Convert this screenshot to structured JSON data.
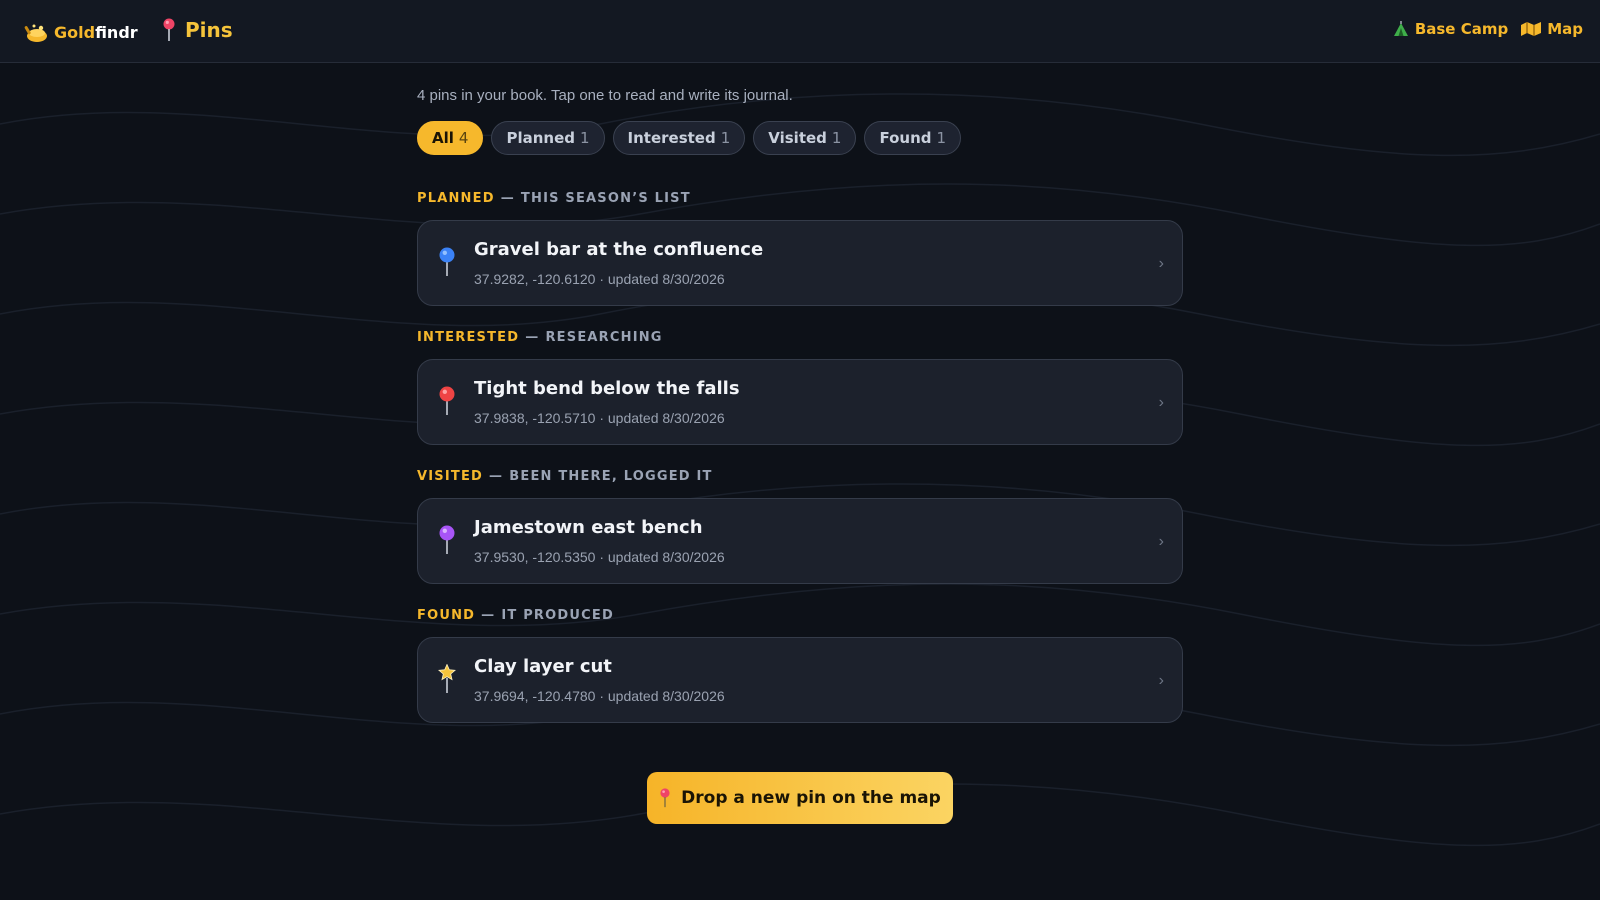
{
  "header": {
    "brand_prefix": "Gold",
    "brand_suffix": "findr",
    "page_title": "Pins",
    "nav": [
      {
        "label": "Base Camp",
        "icon": "tent-icon"
      },
      {
        "label": "Map",
        "icon": "map-icon"
      }
    ]
  },
  "intro": "4 pins in your book. Tap one to read and write its journal.",
  "filters": [
    {
      "label": "All",
      "count": "4",
      "active": true
    },
    {
      "label": "Planned",
      "count": "1"
    },
    {
      "label": "Interested",
      "count": "1"
    },
    {
      "label": "Visited",
      "count": "1"
    },
    {
      "label": "Found",
      "count": "1"
    }
  ],
  "sections": [
    {
      "key": "PLANNED",
      "desc": "THIS SEASON’S LIST",
      "pin": {
        "title": "Gravel bar at the confluence",
        "meta": "37.9282, -120.6120 · updated 8/30/2026",
        "icon": "blue-pin-icon",
        "color": "#3b82f6"
      }
    },
    {
      "key": "INTERESTED",
      "desc": "RESEARCHING",
      "pin": {
        "title": "Tight bend below the falls",
        "meta": "37.9838, -120.5710 · updated 8/30/2026",
        "icon": "red-pin-icon",
        "color": "#ef4444"
      }
    },
    {
      "key": "VISITED",
      "desc": "BEEN THERE, LOGGED IT",
      "pin": {
        "title": "Jamestown east bench",
        "meta": "37.9530, -120.5350 · updated 8/30/2026",
        "icon": "purple-pin-icon",
        "color": "#a855f7"
      }
    },
    {
      "key": "FOUND",
      "desc": "IT PRODUCED",
      "pin": {
        "title": "Clay layer cut",
        "meta": "37.9694, -120.4780 · updated 8/30/2026",
        "icon": "star-pin-icon",
        "color": "#f6c43b"
      }
    }
  ],
  "separator": "—",
  "chevron": "›",
  "cta": {
    "label": "Drop a new pin on the map",
    "icon": "pushpin-icon"
  },
  "colors": {
    "accent": "#f6b82c",
    "background": "#0d1118",
    "card": "#1c212c"
  }
}
